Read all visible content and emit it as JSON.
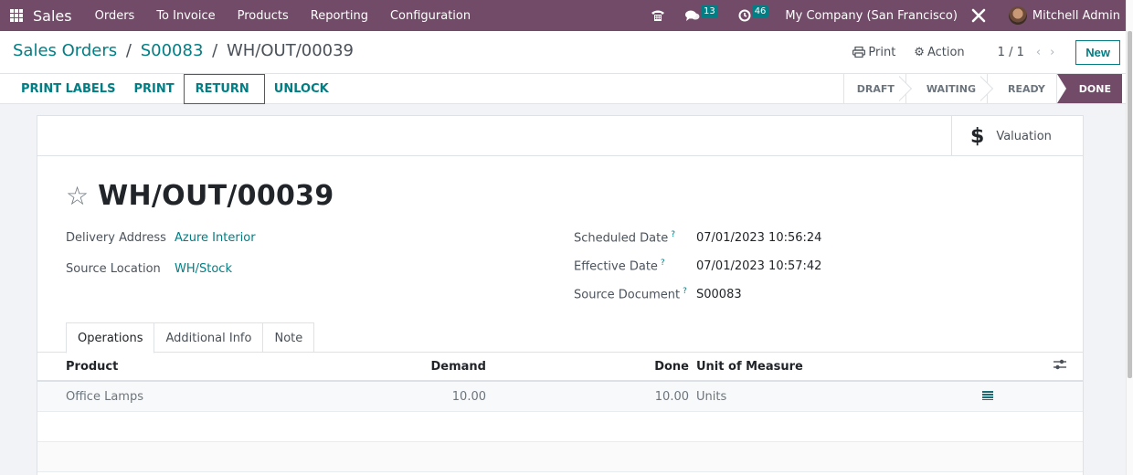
{
  "navbar": {
    "app_name": "Sales",
    "menu": [
      "Orders",
      "To Invoice",
      "Products",
      "Reporting",
      "Configuration"
    ],
    "messages_count": "13",
    "activities_count": "46",
    "company": "My Company (San Francisco)",
    "user": "Mitchell Admin",
    "icons": {
      "apps": "apps-grid-icon",
      "phone": "phone-icon",
      "messages": "chat-bubbles-icon",
      "activities": "clock-icon",
      "debug": "tools-icon"
    },
    "bg_color": "#714b67"
  },
  "control_panel": {
    "breadcrumb": [
      "Sales Orders",
      "S00083",
      "WH/OUT/00039"
    ],
    "separator": "/",
    "print_label": "Print",
    "action_label": "Action",
    "pager": "1 / 1",
    "pager_prev": "‹",
    "pager_next": "›",
    "new_label": "New"
  },
  "statusbar": {
    "buttons": [
      {
        "label": "PRINT LABELS",
        "highlighted": false
      },
      {
        "label": "PRINT",
        "highlighted": false
      },
      {
        "label": "RETURN",
        "highlighted": true
      },
      {
        "label": "UNLOCK",
        "highlighted": false
      }
    ],
    "stages": [
      "DRAFT",
      "WAITING",
      "READY",
      "DONE"
    ],
    "current_stage": "DONE"
  },
  "sheet": {
    "smart_button": {
      "icon": "$",
      "label": "Valuation"
    },
    "title": "WH/OUT/00039",
    "left_fields": [
      {
        "label": "Delivery Address",
        "value": "Azure Interior"
      },
      {
        "label": "Source Location",
        "value": "WH/Stock"
      }
    ],
    "right_fields": [
      {
        "label": "Scheduled Date",
        "help": "?",
        "value": "07/01/2023 10:56:24"
      },
      {
        "label": "Effective Date",
        "help": "?",
        "value": "07/01/2023 10:57:42"
      },
      {
        "label": "Source Document",
        "help": "?",
        "value": "S00083"
      }
    ],
    "tabs": [
      "Operations",
      "Additional Info",
      "Note"
    ],
    "active_tab": "Operations",
    "table": {
      "columns": [
        "Product",
        "Demand",
        "Done",
        "Unit of Measure"
      ],
      "rows": [
        {
          "product": "Office Lamps",
          "demand": "10.00",
          "done": "10.00",
          "uom": "Units"
        }
      ]
    }
  },
  "colors": {
    "brand": "#714b67",
    "link": "#017e84",
    "highlight_border": "#e02020"
  }
}
